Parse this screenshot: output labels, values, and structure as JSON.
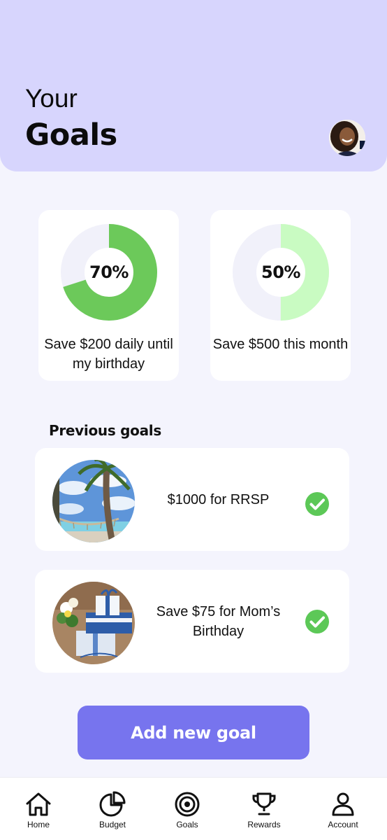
{
  "header": {
    "title_small": "Your",
    "title_big": "Goals",
    "avatar_icon": "user-avatar"
  },
  "current_goals": [
    {
      "percent": 70,
      "percent_label": "70%",
      "description": "Save $200 daily until my birthday",
      "color": "#6cc95a"
    },
    {
      "percent": 50,
      "percent_label": "50%",
      "description": "Save $500 this month",
      "color": "#c9fbc2"
    }
  ],
  "previous": {
    "title": "Previous goals",
    "items": [
      {
        "label": "$1000 for RRSP",
        "image": "beach-hammock-photo",
        "status_icon": "check-circle-icon"
      },
      {
        "label": "Save $75 for Mom’s Birthday",
        "image": "gift-boxes-photo",
        "status_icon": "check-circle-icon"
      }
    ]
  },
  "actions": {
    "add_goal": "Add new goal"
  },
  "nav": [
    {
      "label": "Home",
      "icon": "home-icon"
    },
    {
      "label": "Budget",
      "icon": "pie-chart-icon"
    },
    {
      "label": "Goals",
      "icon": "target-icon"
    },
    {
      "label": "Rewards",
      "icon": "trophy-icon"
    },
    {
      "label": "Account",
      "icon": "user-icon"
    }
  ],
  "colors": {
    "header_bg": "#d7d5fd",
    "page_bg": "#f4f4fd",
    "accent": "#7774ee",
    "success": "#5cc857"
  }
}
